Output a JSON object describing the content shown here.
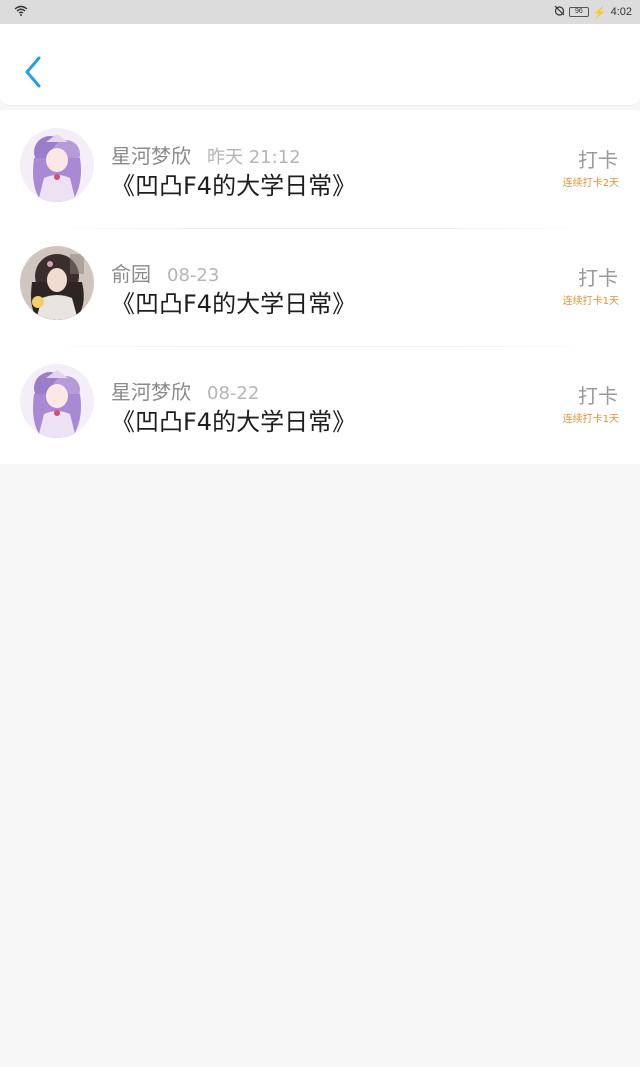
{
  "status_bar": {
    "time": "4:02",
    "battery": "96"
  },
  "header": {
    "back_icon": "chevron-left-icon",
    "accent": "#2a9fe0"
  },
  "records": [
    {
      "user": "星河梦欣",
      "time": "昨天  21:12",
      "title": "《凹凸F4的大学日常》",
      "action": "打卡",
      "streak": "连续打卡2天",
      "avatar": "purple"
    },
    {
      "user": "俞园",
      "time": "08-23",
      "title": "《凹凸F4的大学日常》",
      "action": "打卡",
      "streak": "连续打卡1天",
      "avatar": "dark"
    },
    {
      "user": "星河梦欣",
      "time": "08-22",
      "title": "《凹凸F4的大学日常》",
      "action": "打卡",
      "streak": "连续打卡1天",
      "avatar": "purple"
    }
  ],
  "colors": {
    "streak": "#e8913a",
    "background": "#f8f7f7"
  }
}
